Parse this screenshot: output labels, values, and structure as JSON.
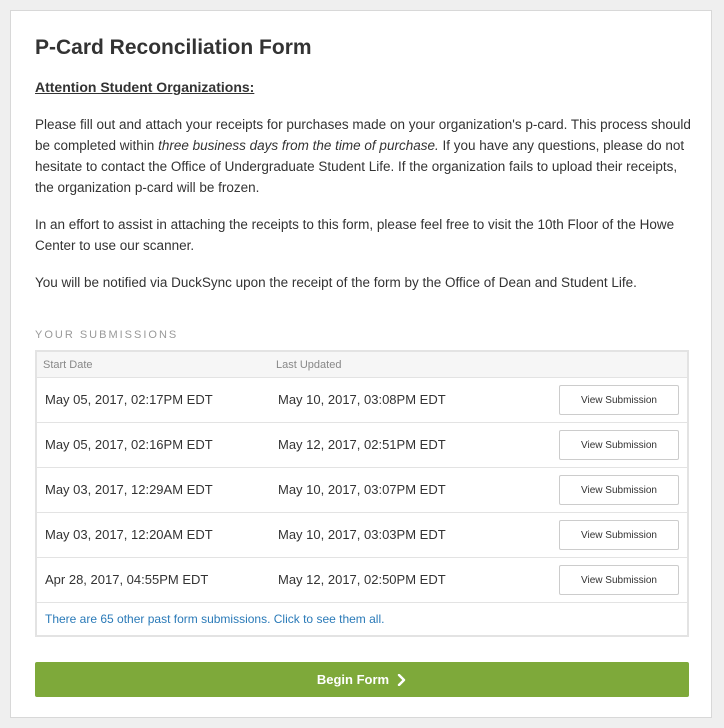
{
  "form": {
    "title": "P-Card Reconciliation Form",
    "attention": "Attention Student Organizations:",
    "p1_a": "Please fill out and attach your receipts for purchases made on your organization's p-card. This process should be completed within ",
    "p1_em": "three business days from the time of purchase.",
    "p1_b": " If you have any questions, please do not hesitate to contact the Office of Undergraduate Student Life. If the organization fails to upload their receipts, the organization p-card will be frozen.",
    "p2": "In an effort to assist in attaching the receipts to this form, please feel free to visit the 10th Floor of the Howe Center to use our scanner.",
    "p3": "You will be notified via DuckSync upon the receipt of the form by the Office of Dean and Student Life."
  },
  "submissions": {
    "label": "YOUR SUBMISSIONS",
    "columns": {
      "start": "Start Date",
      "updated": "Last Updated"
    },
    "rows": [
      {
        "start": "May 05, 2017, 02:17PM EDT",
        "updated": "May 10, 2017, 03:08PM EDT",
        "action": "View Submission"
      },
      {
        "start": "May 05, 2017, 02:16PM EDT",
        "updated": "May 12, 2017, 02:51PM EDT",
        "action": "View Submission"
      },
      {
        "start": "May 03, 2017, 12:29AM EDT",
        "updated": "May 10, 2017, 03:07PM EDT",
        "action": "View Submission"
      },
      {
        "start": "May 03, 2017, 12:20AM EDT",
        "updated": "May 10, 2017, 03:03PM EDT",
        "action": "View Submission"
      },
      {
        "start": "Apr 28, 2017, 04:55PM EDT",
        "updated": "May 12, 2017, 02:50PM EDT",
        "action": "View Submission"
      }
    ],
    "more_link": "There are 65 other past form submissions. Click to see them all."
  },
  "begin": {
    "label": "Begin Form",
    "icon": "chevron-right-icon"
  },
  "colors": {
    "accent": "#7ea93a",
    "link": "#2a7ab8"
  }
}
